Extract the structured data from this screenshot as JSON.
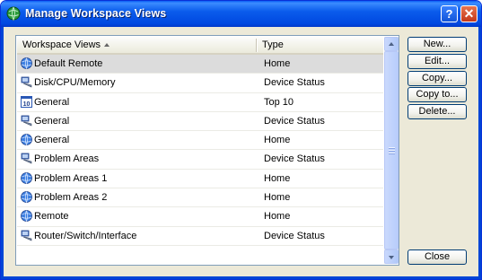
{
  "window": {
    "title": "Manage Workspace Views",
    "help_label": "?",
    "close_label": "✕"
  },
  "list": {
    "columns": [
      "Workspace Views",
      "Type"
    ],
    "sort_column": "Workspace Views",
    "sort_direction": "ascending",
    "rows": [
      {
        "name": "Default Remote",
        "type": "Home",
        "icon": "globe-icon",
        "selected": true
      },
      {
        "name": "Disk/CPU/Memory",
        "type": "Device Status",
        "icon": "device-status-icon"
      },
      {
        "name": "General",
        "type": "Top 10",
        "icon": "top-ten-icon"
      },
      {
        "name": "General",
        "type": "Device Status",
        "icon": "device-status-icon"
      },
      {
        "name": "General",
        "type": "Home",
        "icon": "globe-icon"
      },
      {
        "name": "Problem Areas",
        "type": "Device Status",
        "icon": "device-status-icon"
      },
      {
        "name": "Problem Areas 1",
        "type": "Home",
        "icon": "globe-icon"
      },
      {
        "name": "Problem Areas 2",
        "type": "Home",
        "icon": "globe-icon"
      },
      {
        "name": "Remote",
        "type": "Home",
        "icon": "globe-icon"
      },
      {
        "name": "Router/Switch/Interface",
        "type": "Device Status",
        "icon": "device-status-icon"
      }
    ]
  },
  "buttons": {
    "new": "New...",
    "edit": "Edit...",
    "copy": "Copy...",
    "copy_to": "Copy to...",
    "delete": "Delete...",
    "close": "Close"
  },
  "colors": {
    "titlebar": "#0048e0",
    "dialog_bg": "#ece9d8",
    "selected_row": "#dcdcdc"
  }
}
